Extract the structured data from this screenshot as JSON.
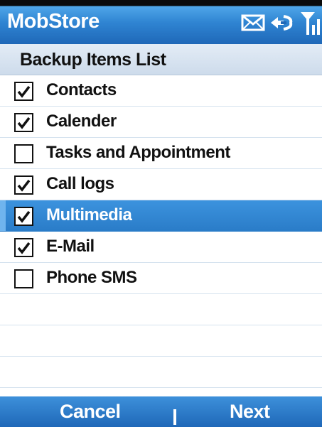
{
  "app": {
    "title": "MobStore"
  },
  "status": {
    "icons": [
      "mail-icon",
      "connection-icon",
      "signal-icon"
    ]
  },
  "header": {
    "title": "Backup Items List"
  },
  "items": [
    {
      "label": "Contacts",
      "checked": true,
      "selected": false
    },
    {
      "label": "Calender",
      "checked": true,
      "selected": false
    },
    {
      "label": "Tasks and Appointment",
      "checked": false,
      "selected": false
    },
    {
      "label": "Call logs",
      "checked": true,
      "selected": false
    },
    {
      "label": "Multimedia",
      "checked": true,
      "selected": true
    },
    {
      "label": "E-Mail",
      "checked": true,
      "selected": false
    },
    {
      "label": "Phone SMS",
      "checked": false,
      "selected": false
    }
  ],
  "softkeys": {
    "left": "Cancel",
    "right": "Next"
  },
  "colors": {
    "titlebar": "#2f84d2",
    "selection": "#3c93de",
    "header": "#d6e2ef"
  }
}
